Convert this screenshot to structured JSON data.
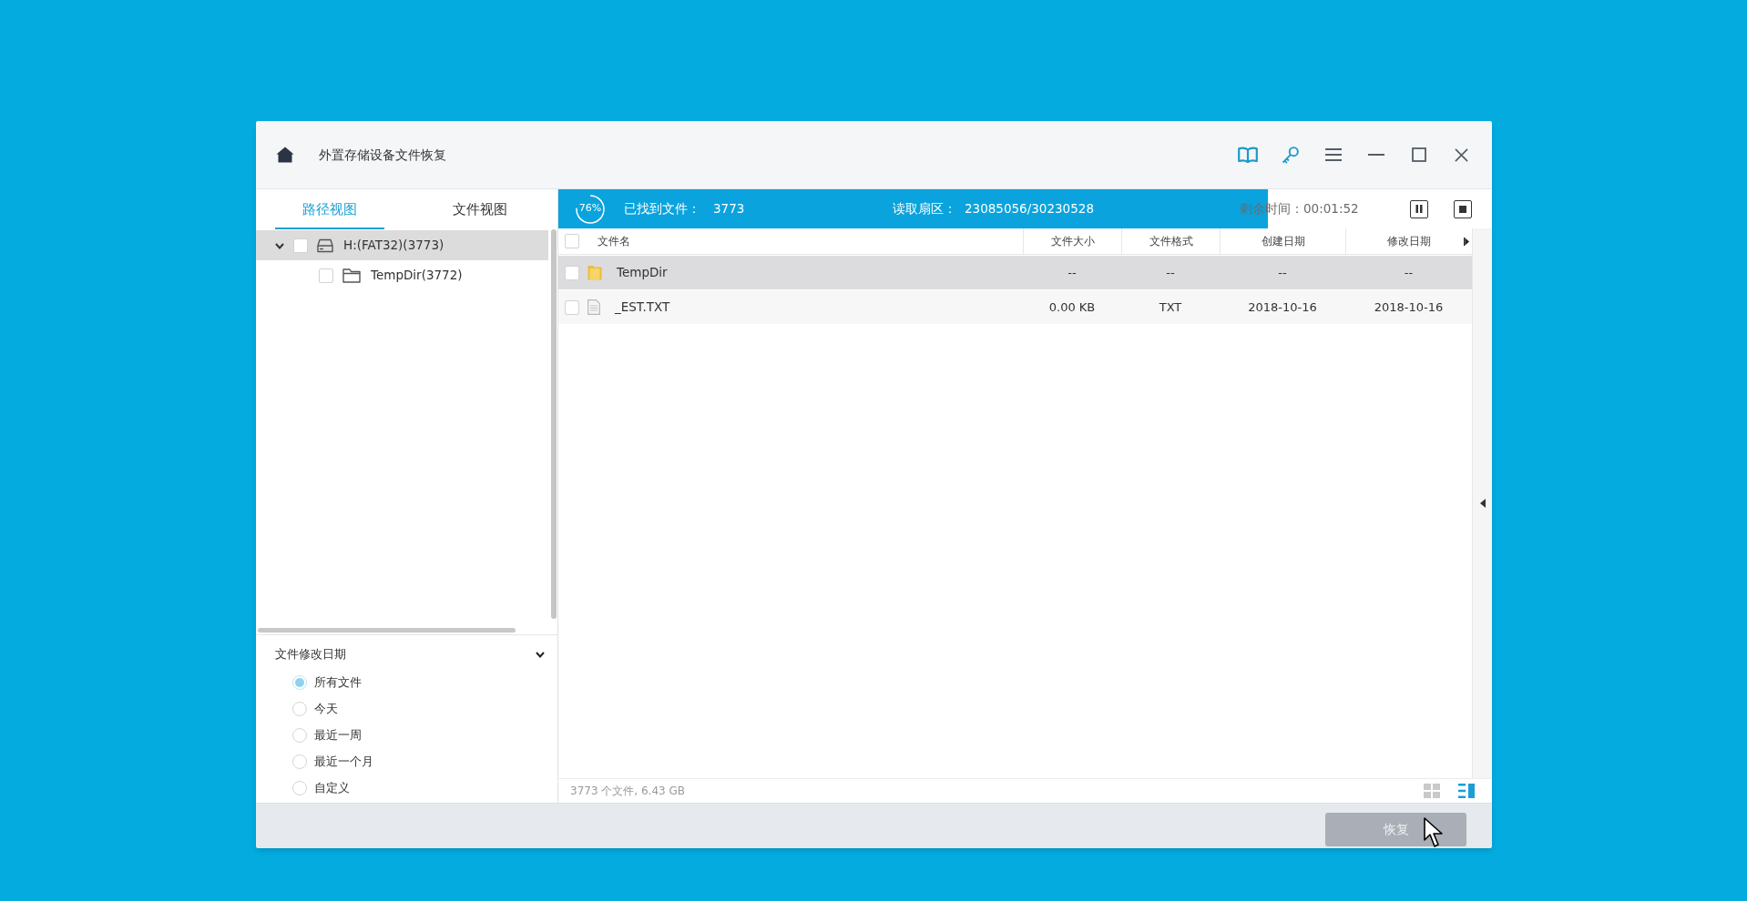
{
  "window": {
    "title": "外置存储设备文件恢复"
  },
  "left_panel": {
    "tabs": [
      {
        "label": "路径视图",
        "selected": true
      },
      {
        "label": "文件视图",
        "selected": false
      }
    ],
    "tree": [
      {
        "kind": "drive",
        "label": "H:(FAT32)(3773)",
        "checked": false,
        "selected": true,
        "expanded": true,
        "children": [
          {
            "kind": "folder",
            "label": "TempDir(3772)",
            "checked": false,
            "selected": false
          }
        ]
      }
    ],
    "filter": {
      "title": "文件修改日期",
      "expanded": true,
      "options": [
        {
          "label": "所有文件",
          "selected": true
        },
        {
          "label": "今天",
          "selected": false
        },
        {
          "label": "最近一周",
          "selected": false
        },
        {
          "label": "最近一个月",
          "selected": false
        },
        {
          "label": "自定义",
          "selected": false
        }
      ]
    }
  },
  "scan": {
    "percent": "76%",
    "level": 0.76,
    "found_label": "已找到文件：",
    "found_count": "3773",
    "sectors_label": "读取扇区：",
    "sectors": "23085056/30230528",
    "remaining": "剩余时间：00:01:52"
  },
  "table": {
    "select_all_checked": false,
    "columns": [
      "文件名",
      "文件大小",
      "文件格式",
      "创建日期",
      "修改日期"
    ],
    "rows": [
      {
        "kind": "folder",
        "selected": true,
        "checked": false,
        "cells": [
          "TempDir",
          "--",
          "--",
          "--",
          "--"
        ]
      },
      {
        "kind": "file",
        "selected": false,
        "checked": false,
        "cells": [
          "_EST.TXT",
          "0.00 KB",
          "TXT",
          "2018-10-16",
          "2018-10-16"
        ]
      }
    ]
  },
  "status_bar": {
    "summary": "3773 个文件, 6.43 GB",
    "views": [
      {
        "kind": "grid",
        "selected": false
      },
      {
        "kind": "list",
        "selected": true
      }
    ]
  },
  "footer": {
    "recover_button": {
      "label": "恢复",
      "disabled": true
    }
  }
}
